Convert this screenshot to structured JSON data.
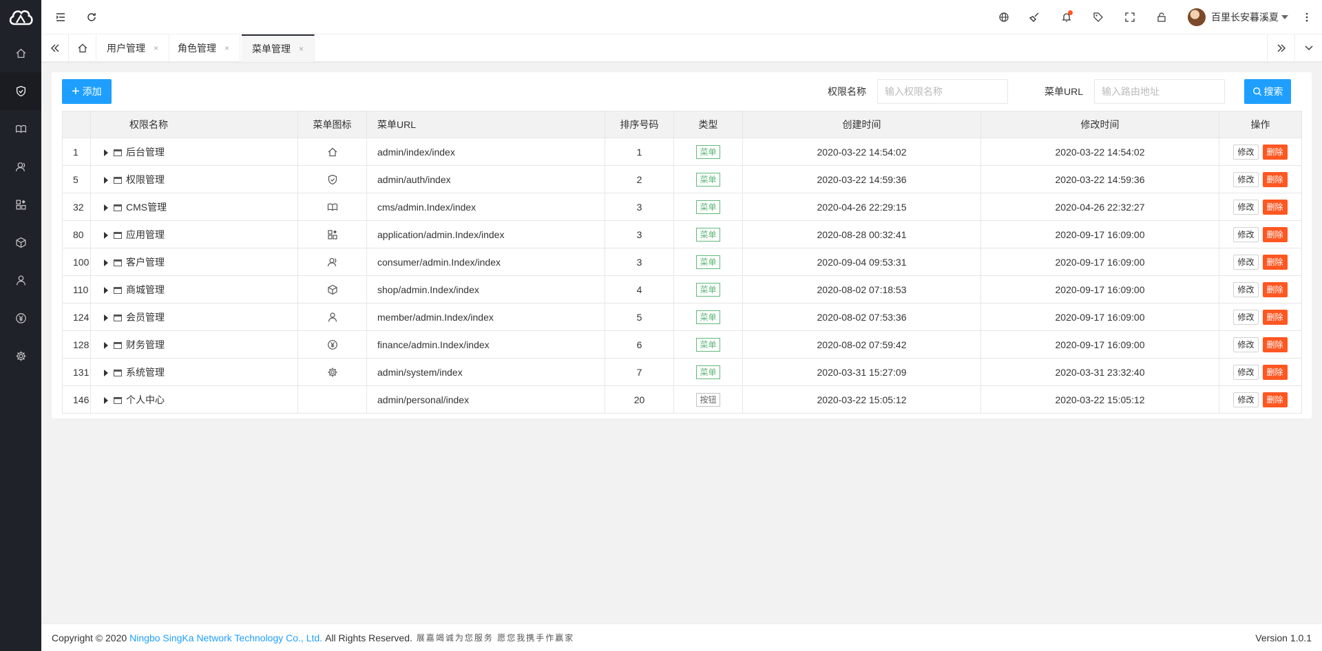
{
  "sidebar": {
    "logo_icon": "cloud-icon",
    "items": [
      {
        "icon": "home-icon"
      },
      {
        "icon": "shield-check-icon",
        "active": true
      },
      {
        "icon": "book-icon"
      },
      {
        "icon": "users-icon"
      },
      {
        "icon": "apps-icon"
      },
      {
        "icon": "cube-icon"
      },
      {
        "icon": "user-icon"
      },
      {
        "icon": "yen-icon"
      },
      {
        "icon": "gear-icon"
      }
    ]
  },
  "header": {
    "icons": [
      "menu-fold-icon",
      "refresh-icon",
      "globe-icon",
      "broom-icon",
      "bell-icon",
      "tag-icon",
      "fullscreen-icon",
      "lock-icon",
      "more-vertical-icon"
    ],
    "user_name": "百里长安暮溪夏"
  },
  "tabs": {
    "items": [
      {
        "label": "用户管理",
        "close": "×"
      },
      {
        "label": "角色管理",
        "close": "×"
      },
      {
        "label": "菜单管理",
        "close": "×",
        "active": true
      }
    ]
  },
  "toolbar": {
    "add_label": "添加",
    "add_symbol": "+",
    "filter_name_label": "权限名称",
    "filter_name_placeholder": "输入权限名称",
    "filter_url_label": "菜单URL",
    "filter_url_placeholder": "输入路由地址",
    "search_label": "搜索"
  },
  "table": {
    "headers": [
      "",
      "权限名称",
      "菜单图标",
      "菜单URL",
      "排序号码",
      "类型",
      "创建时间",
      "修改时间",
      "操作"
    ],
    "edit_label": "修改",
    "delete_label": "删除",
    "rows": [
      {
        "id": "1",
        "name": "后台管理",
        "icon": "home-icon",
        "url": "admin/index/index",
        "sort": "1",
        "type": "菜单",
        "type_kind": "menu",
        "created": "2020-03-22 14:54:02",
        "updated": "2020-03-22 14:54:02"
      },
      {
        "id": "5",
        "name": "权限管理",
        "icon": "shield-check-icon",
        "url": "admin/auth/index",
        "sort": "2",
        "type": "菜单",
        "type_kind": "menu",
        "created": "2020-03-22 14:59:36",
        "updated": "2020-03-22 14:59:36"
      },
      {
        "id": "32",
        "name": "CMS管理",
        "icon": "book-icon",
        "url": "cms/admin.Index/index",
        "sort": "3",
        "type": "菜单",
        "type_kind": "menu",
        "created": "2020-04-26 22:29:15",
        "updated": "2020-04-26 22:32:27"
      },
      {
        "id": "80",
        "name": "应用管理",
        "icon": "apps-icon",
        "url": "application/admin.Index/index",
        "sort": "3",
        "type": "菜单",
        "type_kind": "menu",
        "created": "2020-08-28 00:32:41",
        "updated": "2020-09-17 16:09:00"
      },
      {
        "id": "100",
        "name": "客户管理",
        "icon": "users-icon",
        "url": "consumer/admin.Index/index",
        "sort": "3",
        "type": "菜单",
        "type_kind": "menu",
        "created": "2020-09-04 09:53:31",
        "updated": "2020-09-17 16:09:00"
      },
      {
        "id": "110",
        "name": "商城管理",
        "icon": "cube-icon",
        "url": "shop/admin.Index/index",
        "sort": "4",
        "type": "菜单",
        "type_kind": "menu",
        "created": "2020-08-02 07:18:53",
        "updated": "2020-09-17 16:09:00"
      },
      {
        "id": "124",
        "name": "会员管理",
        "icon": "user-icon",
        "url": "member/admin.Index/index",
        "sort": "5",
        "type": "菜单",
        "type_kind": "menu",
        "created": "2020-08-02 07:53:36",
        "updated": "2020-09-17 16:09:00"
      },
      {
        "id": "128",
        "name": "财务管理",
        "icon": "yen-icon",
        "url": "finance/admin.Index/index",
        "sort": "6",
        "type": "菜单",
        "type_kind": "menu",
        "created": "2020-08-02 07:59:42",
        "updated": "2020-09-17 16:09:00"
      },
      {
        "id": "131",
        "name": "系统管理",
        "icon": "gear-icon",
        "url": "admin/system/index",
        "sort": "7",
        "type": "菜单",
        "type_kind": "menu",
        "created": "2020-03-31 15:27:09",
        "updated": "2020-03-31 23:32:40"
      },
      {
        "id": "146",
        "name": "个人中心",
        "icon": "",
        "url": "admin/personal/index",
        "sort": "20",
        "type": "按钮",
        "type_kind": "button",
        "created": "2020-03-22 15:05:12",
        "updated": "2020-03-22 15:05:12"
      }
    ]
  },
  "footer": {
    "copyright": "Copyright © 2020",
    "company": "Ningbo SingKa Network Technology Co., Ltd.",
    "rights": "All Rights Reserved.",
    "slogan": "展嘉竭诚为您服务 愿您我携手作赢家",
    "version": "Version 1.0.1"
  },
  "colors": {
    "sidebar_bg": "#20222a",
    "primary": "#1e9fff",
    "danger": "#ff5722",
    "success": "#5fb878"
  }
}
